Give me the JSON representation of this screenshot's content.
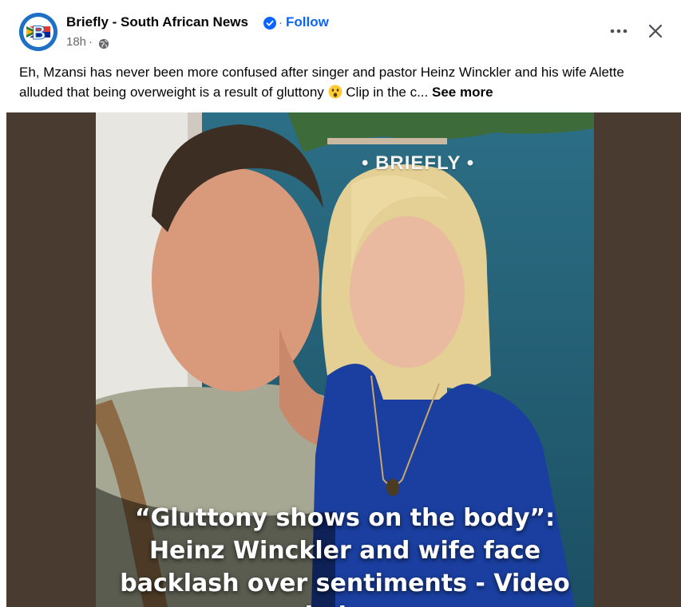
{
  "post": {
    "page_name": "Briefly - South African News",
    "follow_label": "Follow",
    "time": "18h",
    "dot": "·",
    "caption": "Eh, Mzansi has never been more confused after singer and pastor Heinz Winckler and his wife Alette alluded that being overweight is a result of gluttony",
    "caption_tail": "Clip in the c...",
    "see_more_label": "See more",
    "more_icon": "more-horizontal-icon",
    "close_icon": "close-icon",
    "verified_icon": "verified-badge-icon",
    "audience_icon": "globe-icon"
  },
  "media": {
    "watermark": "• BRIEFLY •",
    "headline": "“Gluttony shows on the body”: Heinz Winckler and wife face backlash over sentiments - Video below"
  },
  "colors": {
    "accent": "#0866ff",
    "secondary_text": "#65676b",
    "media_background": "#4a3b30"
  }
}
